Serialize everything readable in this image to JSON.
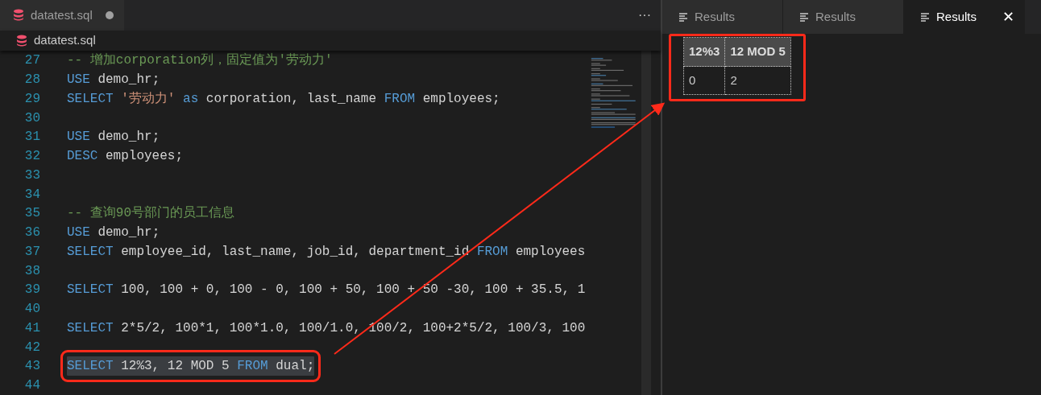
{
  "editor": {
    "tab": {
      "title": "datatest.sql",
      "modified": true
    },
    "more": "···",
    "breadcrumb": "datatest.sql",
    "lines": [
      {
        "number": "27",
        "selected": false,
        "tokens": [
          {
            "kind": "comment",
            "text": "-- 增加corporation列，固定值为'劳动力'"
          }
        ]
      },
      {
        "number": "28",
        "selected": false,
        "tokens": [
          {
            "kind": "keyword",
            "text": "USE"
          },
          {
            "kind": "plain",
            "text": " demo_hr;"
          }
        ]
      },
      {
        "number": "29",
        "selected": false,
        "tokens": [
          {
            "kind": "keyword",
            "text": "SELECT "
          },
          {
            "kind": "string",
            "text": "'劳动力'"
          },
          {
            "kind": "keyword",
            "text": " as"
          },
          {
            "kind": "plain",
            "text": " corporation, last_name "
          },
          {
            "kind": "keyword",
            "text": "FROM"
          },
          {
            "kind": "plain",
            "text": " employees;"
          }
        ]
      },
      {
        "number": "30",
        "selected": false
      },
      {
        "number": "31",
        "selected": false,
        "tokens": [
          {
            "kind": "keyword",
            "text": "USE"
          },
          {
            "kind": "plain",
            "text": " demo_hr;"
          }
        ]
      },
      {
        "number": "32",
        "selected": false,
        "tokens": [
          {
            "kind": "keyword",
            "text": "DESC"
          },
          {
            "kind": "plain",
            "text": " employees;"
          }
        ]
      },
      {
        "number": "33",
        "selected": false
      },
      {
        "number": "34",
        "selected": false
      },
      {
        "number": "35",
        "selected": false,
        "tokens": [
          {
            "kind": "comment",
            "text": "-- 查询90号部门的员工信息"
          }
        ]
      },
      {
        "number": "36",
        "selected": false,
        "tokens": [
          {
            "kind": "keyword",
            "text": "USE"
          },
          {
            "kind": "plain",
            "text": " demo_hr;"
          }
        ]
      },
      {
        "number": "37",
        "selected": false,
        "tokens": [
          {
            "kind": "keyword",
            "text": "SELECT"
          },
          {
            "kind": "plain",
            "text": " employee_id, last_name, job_id, department_id "
          },
          {
            "kind": "keyword",
            "text": "FROM"
          },
          {
            "kind": "plain",
            "text": " employees"
          }
        ]
      },
      {
        "number": "38",
        "selected": false
      },
      {
        "number": "39",
        "selected": false,
        "tokens": [
          {
            "kind": "keyword",
            "text": "SELECT"
          },
          {
            "kind": "plain",
            "text": " 100, 100 + 0, 100 - 0, 100 + 50, 100 + 50 -30, 100 + 35.5, 1"
          }
        ]
      },
      {
        "number": "40",
        "selected": false
      },
      {
        "number": "41",
        "selected": false,
        "tokens": [
          {
            "kind": "keyword",
            "text": "SELECT"
          },
          {
            "kind": "plain",
            "text": " 2*5/2, 100*1, 100*1.0, 100/1.0, 100/2, 100+2*5/2, 100/3, 100"
          }
        ]
      },
      {
        "number": "42",
        "selected": false
      },
      {
        "number": "43",
        "selected": true,
        "tokens": [
          {
            "kind": "keyword",
            "text": "SELECT"
          },
          {
            "kind": "plain",
            "text": " 12%3, 12 MOD 5 "
          },
          {
            "kind": "keyword",
            "text": "FROM"
          },
          {
            "kind": "plain",
            "text": " dual;"
          }
        ]
      },
      {
        "number": "44",
        "selected": false
      }
    ]
  },
  "results": {
    "tabs": [
      {
        "label": "Results",
        "selected": false
      },
      {
        "label": "Results",
        "selected": false
      },
      {
        "label": "Results",
        "selected": true
      }
    ],
    "close": "✕",
    "table": {
      "columns": [
        "12%3",
        "12 MOD 5"
      ],
      "rows": [
        [
          "0",
          "2"
        ]
      ]
    }
  }
}
